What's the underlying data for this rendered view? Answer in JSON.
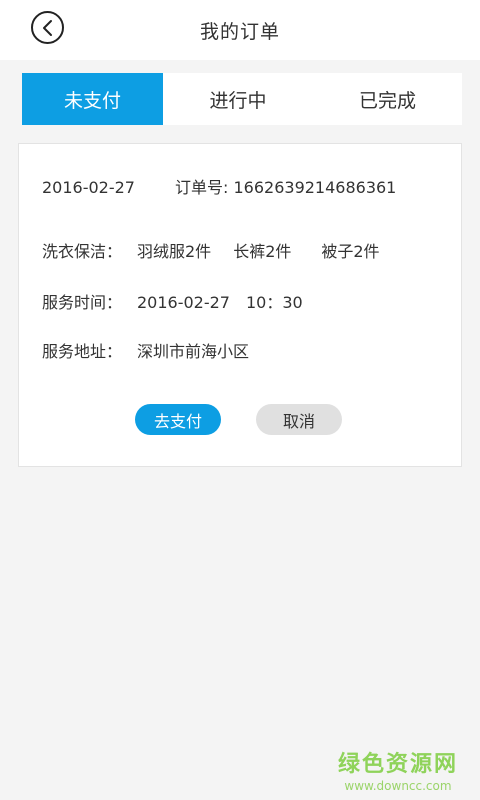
{
  "header": {
    "title": "我的订单",
    "back_icon": "chevron-left-icon"
  },
  "tabs": [
    {
      "label": "未支付",
      "active": true
    },
    {
      "label": "进行中",
      "active": false
    },
    {
      "label": "已完成",
      "active": false
    }
  ],
  "order": {
    "date": "2016-02-27",
    "order_label": "订单号:",
    "order_number": "1662639214686361",
    "laundry_label": "洗衣保洁：",
    "items": [
      "羽绒服2件",
      "长裤2件",
      "被子2件"
    ],
    "time_label": "服务时间：",
    "time_value": "2016-02-27　10：30",
    "address_label": "服务地址：",
    "address_value": "深圳市前海小区",
    "pay_label": "去支付",
    "cancel_label": "取消"
  },
  "watermark": {
    "main": "绿色资源网",
    "url": "www.downcc.com"
  },
  "colors": {
    "accent": "#0d9ee3",
    "background": "#f4f4f4",
    "cancel": "#e0e0e0"
  }
}
